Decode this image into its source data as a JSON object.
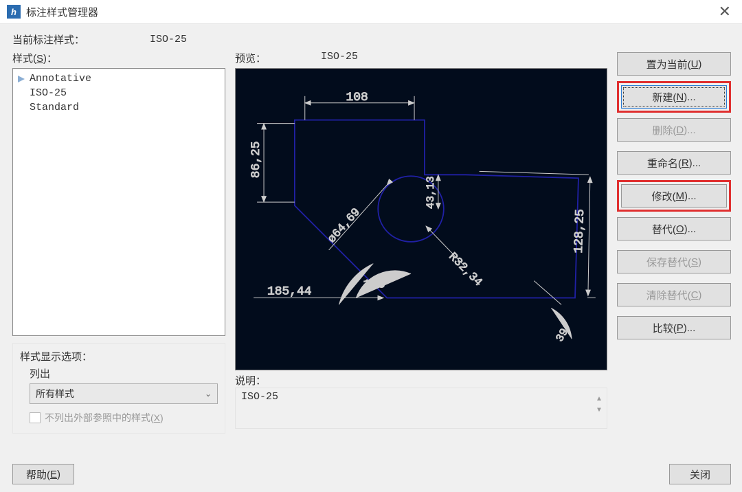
{
  "window": {
    "title": "标注样式管理器",
    "close_glyph": "✕"
  },
  "info": {
    "current_label": "当前标注样式：",
    "current_value": "ISO-25",
    "styles_label_pre": "样式(",
    "styles_label_u": "S",
    "styles_label_post": ")："
  },
  "styles_list": [
    "Annotative",
    "ISO-25",
    "Standard"
  ],
  "display_options": {
    "group_title": "样式显示选项：",
    "list_label": "列出",
    "dropdown_value": "所有样式",
    "checkbox_pre": "不列出外部参照中的样式(",
    "checkbox_u": "X",
    "checkbox_post": ")"
  },
  "preview": {
    "label": "预览：",
    "value": "ISO-25",
    "dims": {
      "d108": "108",
      "d8625": "86,25",
      "d4313": "43,13",
      "d12825": "128,25",
      "r3234": "R32,34",
      "dia6469": "ø64,69",
      "a125": "125°",
      "d18544": "185,44",
      "a39": "39°"
    }
  },
  "description": {
    "label": "说明：",
    "value": "ISO-25"
  },
  "buttons": {
    "set_current_pre": "置为当前(",
    "set_current_u": "U",
    "set_current_post": ")",
    "new_pre": "新建(",
    "new_u": "N",
    "new_post": ")...",
    "delete_pre": "删除(",
    "delete_u": "D",
    "delete_post": ")...",
    "rename_pre": "重命名(",
    "rename_u": "R",
    "rename_post": ")...",
    "modify_pre": "修改(",
    "modify_u": "M",
    "modify_post": ")...",
    "override_pre": "替代(",
    "override_u": "O",
    "override_post": ")...",
    "save_override_pre": "保存替代(",
    "save_override_u": "S",
    "save_override_post": ")",
    "clear_override_pre": "清除替代(",
    "clear_override_u": "C",
    "clear_override_post": ")",
    "compare_pre": "比较(",
    "compare_u": "P",
    "compare_post": ")...",
    "help_pre": "帮助(",
    "help_u": "E",
    "help_post": ")",
    "close": "关闭"
  }
}
